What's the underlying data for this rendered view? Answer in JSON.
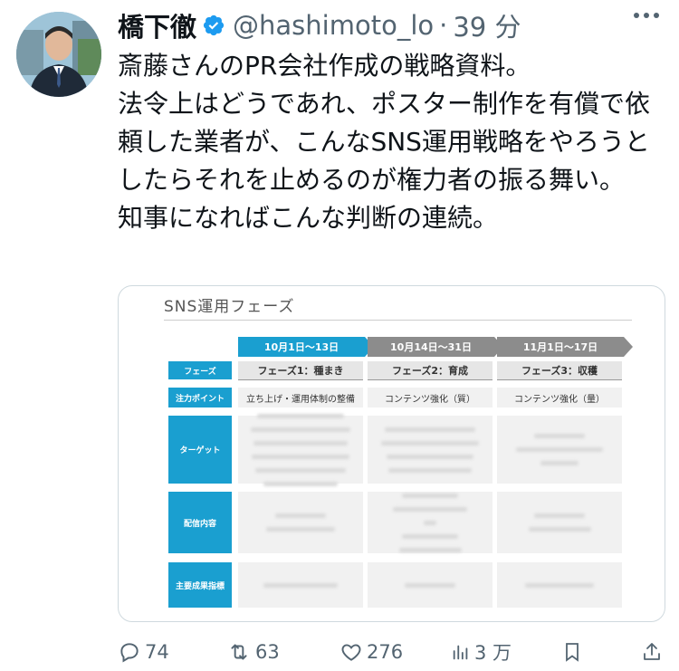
{
  "author": {
    "display_name": "橋下徹",
    "handle": "@hashimoto_lo",
    "time": "39 分",
    "verified_color": "#1d9bf0"
  },
  "tweet": {
    "lines": [
      "斎藤さんのPR会社作成の戦略資料。",
      "法令上はどうであれ、ポスター制作を有償で依頼した業者が、こんなSNS運用戦略をやろうとしたらそれを止めるのが権力者の振る舞い。",
      "知事になればこんな判断の連続。"
    ]
  },
  "attachment": {
    "title": "SNS運用フェーズ",
    "phases": [
      {
        "date": "10月1日～13日",
        "name": "フェーズ1：種まき",
        "focus": "立ち上げ・運用体制の整備"
      },
      {
        "date": "10月14日～31日",
        "name": "フェーズ2：育成",
        "focus": "コンテンツ強化（質）"
      },
      {
        "date": "11月1日～17日",
        "name": "フェーズ3：収穫",
        "focus": "コンテンツ強化（量）"
      }
    ],
    "row_labels": [
      "フェーズ",
      "注力ポイント",
      "ターゲット",
      "配信内容",
      "主要成果指標"
    ],
    "accent_color": "#1a9fd0",
    "inactive_color": "#8c8c8c"
  },
  "actions": {
    "replies": "74",
    "retweets": "63",
    "likes": "276",
    "views": "3 万"
  }
}
